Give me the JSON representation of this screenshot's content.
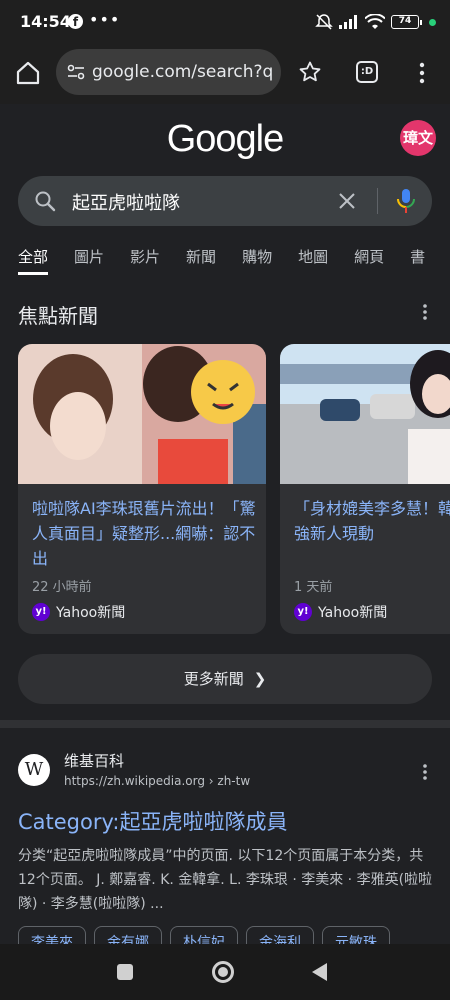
{
  "status_bar": {
    "time": "14:54",
    "dots": "•••",
    "battery": "74"
  },
  "toolbar": {
    "url": "google.com/search?q",
    "tabs_count": ":D"
  },
  "header": {
    "logo": "Google",
    "avatar_text": "璋文"
  },
  "search": {
    "query": "起亞虎啦啦隊"
  },
  "tabs": [
    {
      "label": "全部"
    },
    {
      "label": "圖片"
    },
    {
      "label": "影片"
    },
    {
      "label": "新聞"
    },
    {
      "label": "購物"
    },
    {
      "label": "地圖"
    },
    {
      "label": "網頁"
    },
    {
      "label": "書"
    }
  ],
  "top_stories": {
    "title": "焦點新聞",
    "cards": [
      {
        "headline": "啦啦隊AI李珠珢舊片流出！「驚人真面目」疑整形...網嚇：認不出",
        "time": "22 小時前",
        "source": "Yahoo新聞"
      },
      {
        "headline": "「身材媲美李多慧！韓啦啦隊最強新人現動",
        "time": "1 天前",
        "source": "Yahoo新聞"
      }
    ],
    "more_label": "更多新聞"
  },
  "result": {
    "site_name": "维基百科",
    "site_url": "https://zh.wikipedia.org › zh-tw",
    "title": "Category:起亞虎啦啦隊成員",
    "snippet": "分类“起亞虎啦啦隊成員”中的页面. 以下12个页面属于本分类，共12个页面。 J. 鄭嘉睿. K. 金韓拿. L. 李珠珢 · 李美來 · 李雅英(啦啦隊) · 李多慧(啦啦隊) ...",
    "chips": [
      {
        "label": "李美來"
      },
      {
        "label": "金有娜"
      },
      {
        "label": "朴信妃"
      },
      {
        "label": "金海利"
      },
      {
        "label": "元敏珠"
      }
    ]
  },
  "colors": {
    "link_blue": "#8ab4f8",
    "background": "#202124",
    "avatar_pink": "#e3366c",
    "yahoo_purple": "#6001d2"
  }
}
